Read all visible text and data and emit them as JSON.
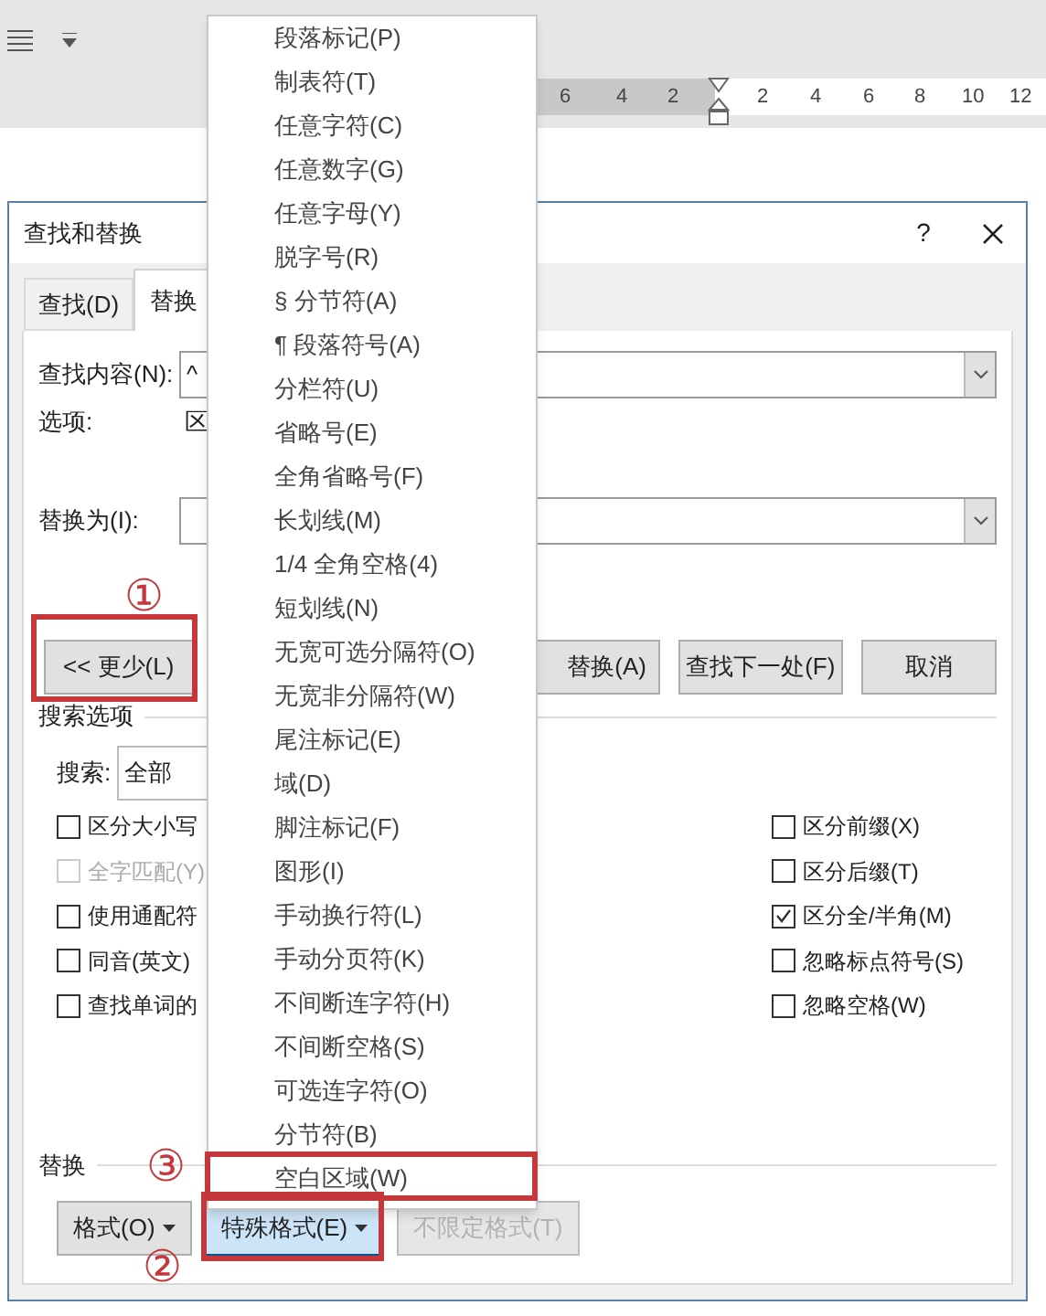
{
  "ruler": {
    "left_numbers": [
      "6",
      "4",
      "2"
    ],
    "right_numbers": [
      "2",
      "4",
      "6",
      "8",
      "10",
      "12"
    ]
  },
  "dialog": {
    "title": "查找和替换",
    "help": "?",
    "tabs": [
      {
        "label": "查找(D)",
        "selected": false
      },
      {
        "label": "替换",
        "selected": true
      }
    ],
    "find_label": "查找内容(N):",
    "find_value": "^",
    "options_label": "选项:",
    "options_value": "区",
    "replace_label": "替换为(I):",
    "buttons": [
      "<< 更少(L)",
      "替换(A)",
      "查找下一处(F)",
      "取消"
    ],
    "search_section": "搜索选项",
    "search_label": "搜索:",
    "search_value": "全部",
    "left_checks": [
      {
        "label": "区分大小写",
        "checked": false,
        "disabled": false
      },
      {
        "label": "全字匹配(Y)",
        "checked": false,
        "disabled": true
      },
      {
        "label": "使用通配符",
        "checked": false,
        "disabled": false
      },
      {
        "label": "同音(英文)",
        "checked": false,
        "disabled": false
      },
      {
        "label": "查找单词的",
        "checked": false,
        "disabled": false
      }
    ],
    "right_checks": [
      {
        "label": "区分前缀(X)",
        "checked": false,
        "disabled": false
      },
      {
        "label": "区分后缀(T)",
        "checked": false,
        "disabled": false
      },
      {
        "label": "区分全/半角(M)",
        "checked": true,
        "disabled": false
      },
      {
        "label": "忽略标点符号(S)",
        "checked": false,
        "disabled": false
      },
      {
        "label": "忽略空格(W)",
        "checked": false,
        "disabled": false
      }
    ],
    "replace_section": "替换",
    "bottom_buttons": [
      {
        "label": "格式(O)",
        "dropdown": true,
        "selected": false,
        "disabled": false
      },
      {
        "label": "特殊格式(E)",
        "dropdown": true,
        "selected": true,
        "disabled": false
      },
      {
        "label": "不限定格式(T)",
        "dropdown": false,
        "selected": false,
        "disabled": true
      }
    ]
  },
  "menu": {
    "items": [
      "段落标记(P)",
      "制表符(T)",
      "任意字符(C)",
      "任意数字(G)",
      "任意字母(Y)",
      "脱字号(R)",
      "§ 分节符(A)",
      "¶ 段落符号(A)",
      "分栏符(U)",
      "省略号(E)",
      "全角省略号(F)",
      "长划线(M)",
      "1/4 全角空格(4)",
      "短划线(N)",
      "无宽可选分隔符(O)",
      "无宽非分隔符(W)",
      "尾注标记(E)",
      "域(D)",
      "脚注标记(F)",
      "图形(I)",
      "手动换行符(L)",
      "手动分页符(K)",
      "不间断连字符(H)",
      "不间断空格(S)",
      "可选连字符(O)",
      "分节符(B)",
      "空白区域(W)"
    ]
  },
  "annotations": [
    "①",
    "③",
    "②"
  ]
}
